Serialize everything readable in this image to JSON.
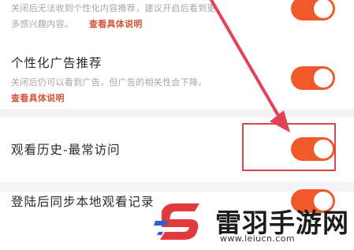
{
  "colors": {
    "toggle_on": "#f05a2a",
    "link": "#d5553a",
    "highlight": "#d84848",
    "arrow": "#e2415a"
  },
  "settings": [
    {
      "title": "",
      "desc_line1": "关闭后无法收到个性化内容推荐，建议开启后看到更",
      "desc_line2": "多感兴趣内容。",
      "link": "查看具体说明",
      "enabled": true
    },
    {
      "title": "个性化广告推荐",
      "desc_line1": "关闭后仍可以看到广告，但广告的相关性会下降。",
      "link": "查看具体说明",
      "enabled": true
    },
    {
      "title": "观看历史-最常访问",
      "enabled": true
    },
    {
      "title": "登陆后同步本地观看记录",
      "enabled": true
    }
  ],
  "watermark": {
    "title": "雷羽手游网",
    "url": "www.leiucn.com"
  }
}
